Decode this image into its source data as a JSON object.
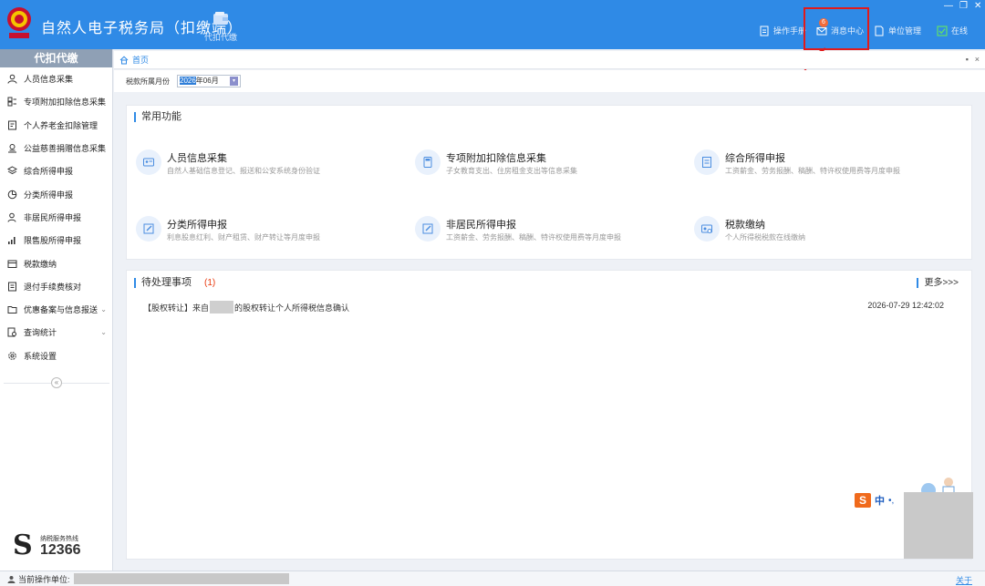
{
  "header": {
    "title": "自然人电子税务局（扣缴端）",
    "nav_label": "代扣代缴",
    "manual_label": "操作手册",
    "message_label": "消息中心",
    "message_badge": "6",
    "unit_label": "单位管理",
    "online_label": "在线"
  },
  "sidebar": {
    "heading": "代扣代缴",
    "items": [
      {
        "label": "人员信息采集",
        "icon": "person-icon"
      },
      {
        "label": "专项附加扣除信息采集",
        "icon": "grid-icon"
      },
      {
        "label": "个人养老金扣除管理",
        "icon": "document-icon"
      },
      {
        "label": "公益慈善捐赠信息采集",
        "icon": "handshake-icon"
      },
      {
        "label": "综合所得申报",
        "icon": "layers-icon"
      },
      {
        "label": "分类所得申报",
        "icon": "pie-icon"
      },
      {
        "label": "非居民所得申报",
        "icon": "user-icon"
      },
      {
        "label": "限售股所得申报",
        "icon": "bar-chart-icon"
      },
      {
        "label": "税款缴纳",
        "icon": "wallet-icon"
      },
      {
        "label": "退付手续费核对",
        "icon": "checklist-icon"
      },
      {
        "label": "优惠备案与信息报送",
        "icon": "folder-icon"
      },
      {
        "label": "查询统计",
        "icon": "search-doc-icon"
      },
      {
        "label": "系统设置",
        "icon": "gear-icon"
      }
    ],
    "collapse_symbol": "«",
    "hotline_small": "纳税服务热线",
    "hotline_number": "12366"
  },
  "breadcrumb": {
    "home_label": "首页"
  },
  "period": {
    "label": "税款所属月份",
    "value_selected": "2026",
    "value_rest": "年06月"
  },
  "common": {
    "title": "常用功能",
    "functions": [
      {
        "name": "人员信息采集",
        "desc": "自然人基础信息登记、报送和公安系统身份验证"
      },
      {
        "name": "专项附加扣除信息采集",
        "desc": "子女教育支出、住房租金支出等信息采集"
      },
      {
        "name": "综合所得申报",
        "desc": "工资薪金、劳务报酬、稿酬、特许权使用费等月度申报"
      },
      {
        "name": "分类所得申报",
        "desc": "利息股息红利、财产租赁、财产转让等月度申报"
      },
      {
        "name": "非居民所得申报",
        "desc": "工资薪金、劳务报酬、稿酬、特许权使用费等月度申报"
      },
      {
        "name": "税款缴纳",
        "desc": "个人所得税税款在线缴纳"
      }
    ]
  },
  "todo": {
    "title": "待处理事项",
    "count": "(1)",
    "more": "更多>>>",
    "item_prefix": "【股权转让】来自",
    "item_suffix": "的股权转让个人所得税信息确认",
    "item_time": "2026-07-29 12:42:02"
  },
  "ime": {
    "logo": "S",
    "lang": "中",
    "dot": "•,"
  },
  "status": {
    "label": "当前操作单位:",
    "about": "关于"
  },
  "colors": {
    "header": "#2f8ae6",
    "accent": "#2f8ae6",
    "annotation": "#e21a1a",
    "badge": "#f26b3a"
  }
}
